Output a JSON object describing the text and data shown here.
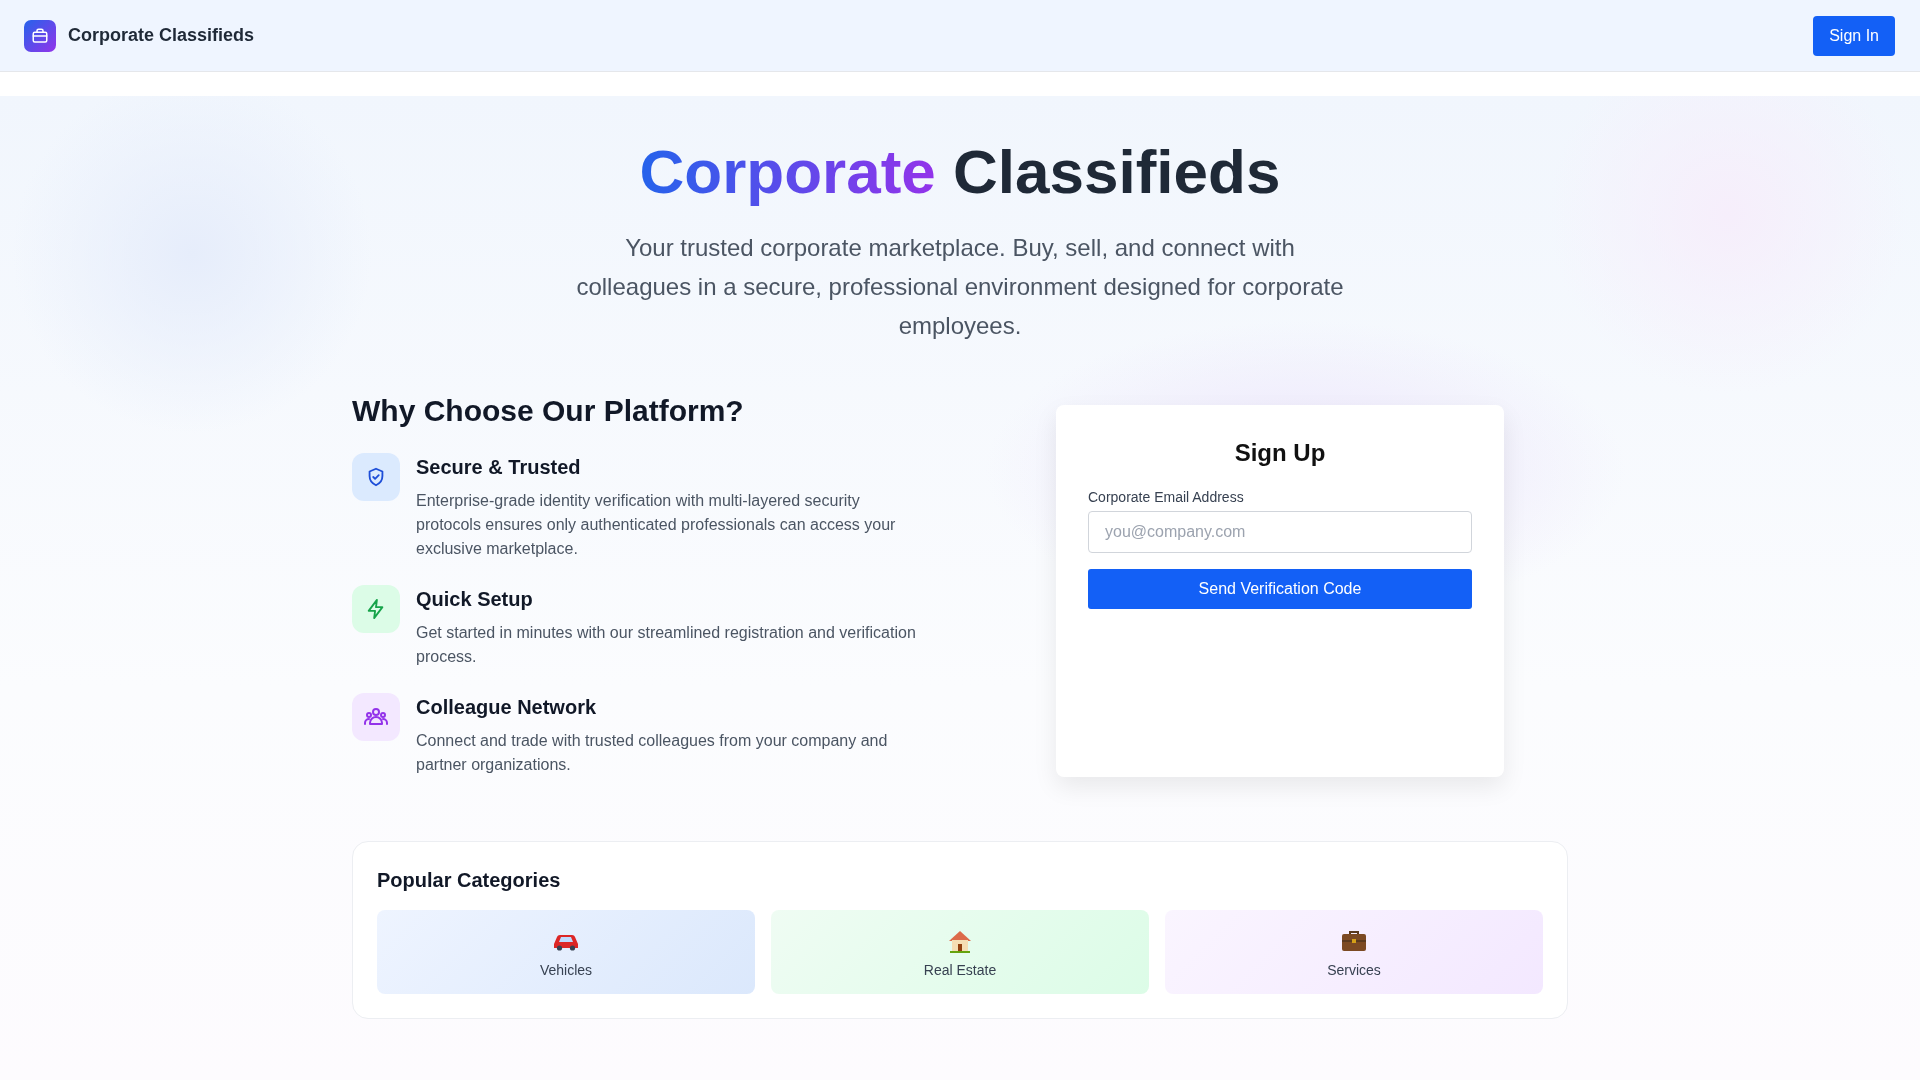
{
  "header": {
    "brand": "Corporate Classifieds",
    "sign_in": "Sign In"
  },
  "hero": {
    "title_highlight": "Corporate",
    "title_rest": "Classifieds",
    "subtitle": "Your trusted corporate marketplace. Buy, sell, and connect with colleagues in a secure, professional environment designed for corporate employees."
  },
  "features": {
    "heading": "Why Choose Our Platform?",
    "items": [
      {
        "kind": "shield",
        "title": "Secure & Trusted",
        "description": "Enterprise-grade identity verification with multi-layered security protocols ensures only authenticated professionals can access your exclusive marketplace."
      },
      {
        "kind": "bolt",
        "title": "Quick Setup",
        "description": "Get started in minutes with our streamlined registration and verification process."
      },
      {
        "kind": "people",
        "title": "Colleague Network",
        "description": "Connect and trade with trusted colleagues from your company and partner organizations."
      }
    ]
  },
  "signup": {
    "title": "Sign Up",
    "email_label": "Corporate Email Address",
    "email_placeholder": "you@company.com",
    "submit": "Send Verification Code"
  },
  "categories": {
    "heading": "Popular Categories",
    "items": [
      {
        "kind": "car",
        "label": "Vehicles"
      },
      {
        "kind": "house",
        "label": "Real Estate"
      },
      {
        "kind": "briefcase",
        "label": "Services"
      }
    ]
  }
}
